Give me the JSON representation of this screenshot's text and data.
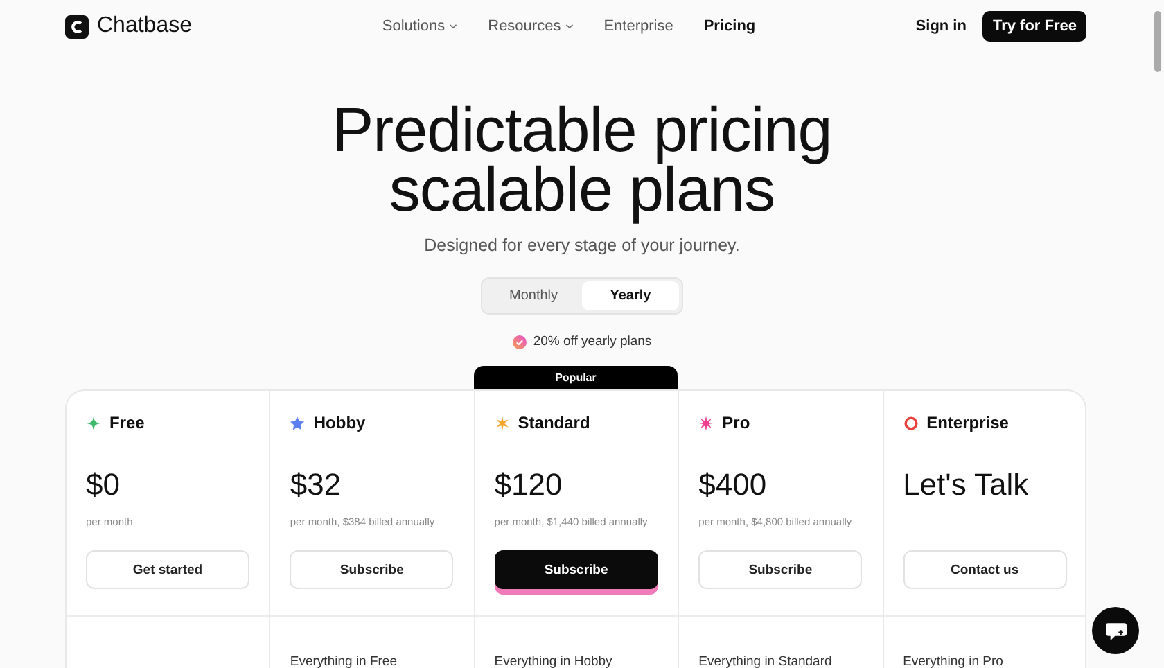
{
  "nav": {
    "brand": "Chatbase",
    "links": [
      {
        "label": "Solutions",
        "dropdown": true,
        "selected": false
      },
      {
        "label": "Resources",
        "dropdown": true,
        "selected": false
      },
      {
        "label": "Enterprise",
        "dropdown": false,
        "selected": false
      },
      {
        "label": "Pricing",
        "dropdown": false,
        "selected": true
      }
    ],
    "sign_in": "Sign in",
    "cta": "Try for Free"
  },
  "hero": {
    "title_lines": [
      "Predictable pricing",
      "scalable plans"
    ],
    "subtitle": "Designed for every stage of your journey."
  },
  "billing_toggle": [
    {
      "label": "Monthly",
      "selected": false
    },
    {
      "label": "Yearly",
      "selected": true
    }
  ],
  "discount_note": "20% off yearly plans",
  "plans": [
    {
      "name": "Free",
      "color": "#3fb96b",
      "price": "$0",
      "note": "per month",
      "button": "Get started",
      "popular": false
    },
    {
      "name": "Hobby",
      "color": "#5b7ff0",
      "price": "$32",
      "note": "per month, $384 billed annually",
      "button": "Subscribe",
      "popular": false,
      "feature": "Everything in Free"
    },
    {
      "name": "Standard",
      "color": "#f4a52c",
      "price": "$120",
      "note": "per month, $1,440 billed annually",
      "button": "Subscribe",
      "popular": true,
      "badge": "Popular",
      "feature": "Everything in Hobby"
    },
    {
      "name": "Pro",
      "color": "#ee3f93",
      "price": "$400",
      "note": "per month, $4,800 billed annually",
      "button": "Subscribe",
      "popular": false,
      "feature": "Everything in Standard"
    },
    {
      "name": "Enterprise",
      "color": "#e8413b",
      "price": "Let's Talk",
      "button": "Contact us",
      "popular": false,
      "feature": "Everything in Pro"
    }
  ]
}
